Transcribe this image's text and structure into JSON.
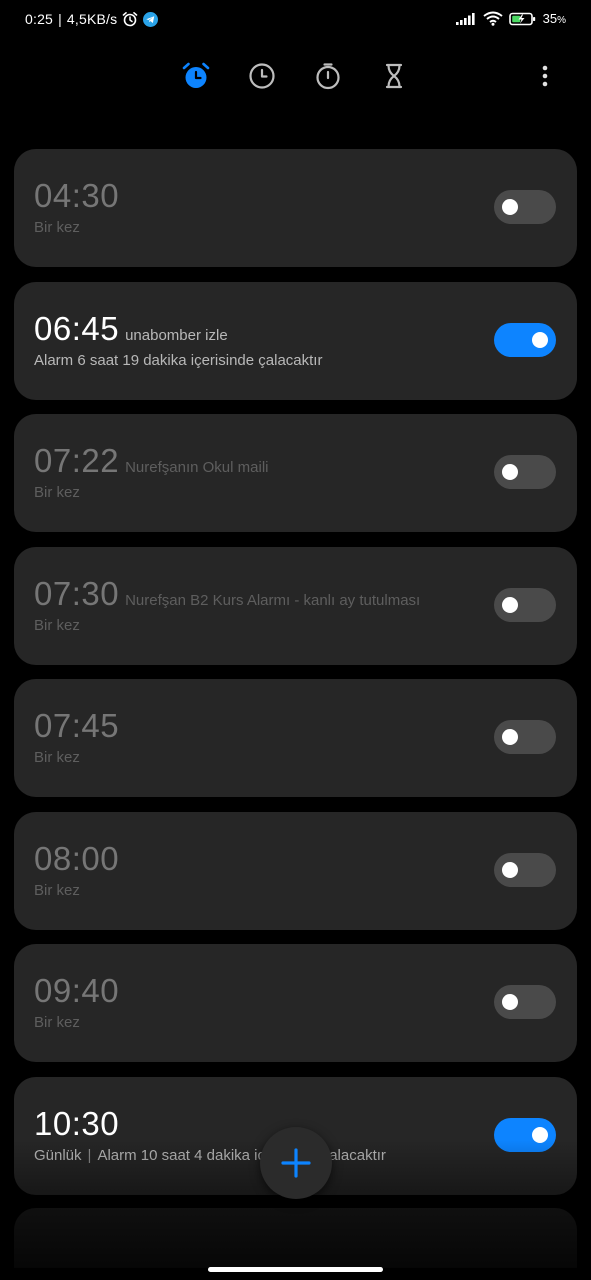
{
  "status_bar": {
    "time": "0:25",
    "separator": "|",
    "speed": "4,5KB/s",
    "battery": "35",
    "battery_unit": "%",
    "icons": [
      "alarm-icon",
      "telegram-icon",
      "signal-icon",
      "wifi-icon",
      "battery-charging-icon"
    ]
  },
  "tabs": [
    {
      "name": "alarm-tab",
      "icon": "alarm-clock-icon",
      "active": true
    },
    {
      "name": "clock-tab",
      "icon": "clock-icon",
      "active": false
    },
    {
      "name": "stopwatch-tab",
      "icon": "stopwatch-icon",
      "active": false
    },
    {
      "name": "timer-tab",
      "icon": "hourglass-icon",
      "active": false
    }
  ],
  "accent_color": "#0d84ff",
  "alarms": [
    {
      "time": "04:30",
      "label": "",
      "subtitle": "Bir kez",
      "enabled": false
    },
    {
      "time": "06:45",
      "label": "unabomber izle",
      "subtitle": "Alarm 6 saat 19 dakika içerisinde çalacaktır",
      "enabled": true
    },
    {
      "time": "07:22",
      "label": "Nurefşanın Okul maili",
      "subtitle": "Bir kez",
      "enabled": false
    },
    {
      "time": "07:30",
      "label": "Nurefşan B2 Kurs Alarmı - kanlı ay tutulması",
      "subtitle": "Bir kez",
      "enabled": false
    },
    {
      "time": "07:45",
      "label": "",
      "subtitle": "Bir kez",
      "enabled": false
    },
    {
      "time": "08:00",
      "label": "",
      "subtitle": "Bir kez",
      "enabled": false
    },
    {
      "time": "09:40",
      "label": "",
      "subtitle": "Bir kez",
      "enabled": false
    },
    {
      "time": "10:30",
      "label": "",
      "subtitle_repeat": "Günlük",
      "subtitle_sep": "|",
      "subtitle": "Alarm 10 saat 4 dakika içerisinde çalacaktır",
      "enabled": true
    }
  ],
  "fab_icon": "plus-icon"
}
